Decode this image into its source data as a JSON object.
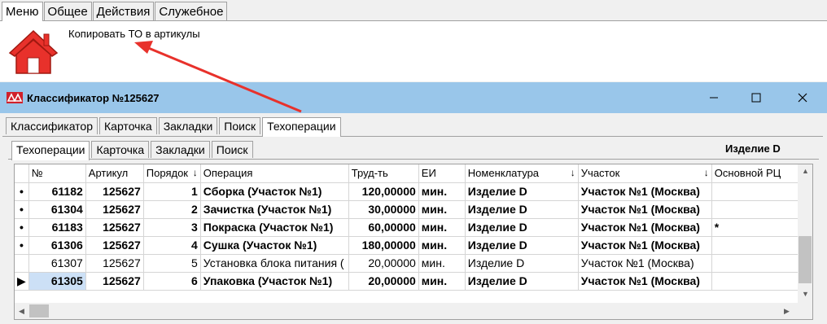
{
  "top_menu": {
    "tabs": [
      "Меню",
      "Общее",
      "Действия",
      "Служебное"
    ],
    "active": 0
  },
  "ribbon": {
    "home_icon": "house-icon",
    "command_label": "Копировать ТО в артикулы",
    "annotation_color": "#e8312b"
  },
  "window": {
    "title": "Классификатор №125627",
    "titlebar_color": "#99c6ea",
    "outer_tabs": [
      "Классификатор",
      "Карточка",
      "Закладки",
      "Поиск",
      "Техоперации"
    ],
    "inner_tabs": [
      "Техоперации",
      "Карточка",
      "Закладки",
      "Поиск"
    ],
    "product_label": "Изделие D"
  },
  "grid": {
    "columns": [
      "№",
      "Артикул",
      "Порядок",
      "Операция",
      "Труд-ть",
      "ЕИ",
      "Номенклатура",
      "Участок",
      "Основной РЦ"
    ],
    "rows": [
      {
        "indicator": "•",
        "no": "61182",
        "article": "125627",
        "order": "1",
        "operation": "Сборка (Участок №1)",
        "labor": "120,00000",
        "unit": "мин.",
        "nomenclature": "Изделие D",
        "section": "Участок №1 (Москва)",
        "main_rc": "",
        "bold": true
      },
      {
        "indicator": "•",
        "no": "61304",
        "article": "125627",
        "order": "2",
        "operation": "Зачистка (Участок №1)",
        "labor": "30,00000",
        "unit": "мин.",
        "nomenclature": "Изделие D",
        "section": "Участок №1 (Москва)",
        "main_rc": "",
        "bold": true
      },
      {
        "indicator": "•",
        "no": "61183",
        "article": "125627",
        "order": "3",
        "operation": "Покраска (Участок №1)",
        "labor": "60,00000",
        "unit": "мин.",
        "nomenclature": "Изделие D",
        "section": "Участок №1 (Москва)",
        "main_rc": "*",
        "bold": true
      },
      {
        "indicator": "•",
        "no": "61306",
        "article": "125627",
        "order": "4",
        "operation": "Сушка (Участок №1)",
        "labor": "180,00000",
        "unit": "мин.",
        "nomenclature": "Изделие D",
        "section": "Участок №1 (Москва)",
        "main_rc": "",
        "bold": true
      },
      {
        "indicator": "",
        "no": "61307",
        "article": "125627",
        "order": "5",
        "operation": "Установка блока питания (",
        "labor": "20,00000",
        "unit": "мин.",
        "nomenclature": "Изделие D",
        "section": "Участок №1 (Москва)",
        "main_rc": "",
        "bold": false
      },
      {
        "indicator": "▶",
        "no": "61305",
        "article": "125627",
        "order": "6",
        "operation": "Упаковка (Участок №1)",
        "labor": "20,00000",
        "unit": "мин.",
        "nomenclature": "Изделие D",
        "section": "Участок №1 (Москва)",
        "main_rc": "",
        "bold": true,
        "selected": true
      }
    ]
  }
}
